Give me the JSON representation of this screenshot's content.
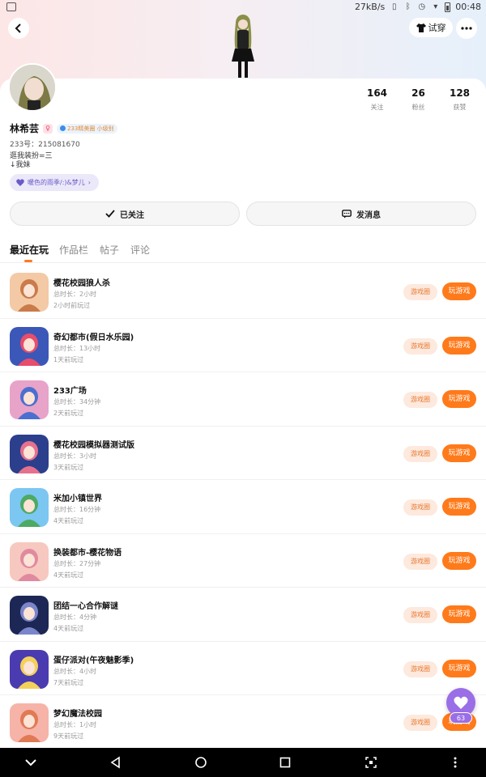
{
  "status_bar": {
    "net_speed": "27kB/s",
    "time": "00:48"
  },
  "header": {
    "tryon_label": "试穿"
  },
  "profile": {
    "name": "林希芸",
    "level_badge": "233精美圈 小级别",
    "account_id": "233号：215081670",
    "bio_line1": "逛我装扮=三",
    "bio_line2": "↓我妹",
    "tag": "暖色的雨季/:)&梦儿",
    "stats": [
      {
        "num": "164",
        "label": "关注"
      },
      {
        "num": "26",
        "label": "粉丝"
      },
      {
        "num": "128",
        "label": "获赞"
      }
    ],
    "follow_label": "已关注",
    "message_label": "发消息"
  },
  "tabs": [
    "最近在玩",
    "作品栏",
    "帖子",
    "评论"
  ],
  "buttons": {
    "circle": "游戏圈",
    "play": "玩游戏"
  },
  "games": [
    {
      "name": "樱花校园狼人杀",
      "duration": "总时长：2小时",
      "last": "2小时前玩过"
    },
    {
      "name": "奇幻都市(假日水乐园)",
      "duration": "总时长：13小时",
      "last": "1天前玩过"
    },
    {
      "name": "233广场",
      "duration": "总时长：34分钟",
      "last": "2天前玩过"
    },
    {
      "name": "樱花校园模拟器测试版",
      "duration": "总时长：3小时",
      "last": "3天前玩过"
    },
    {
      "name": "米加小镇世界",
      "duration": "总时长：16分钟",
      "last": "4天前玩过"
    },
    {
      "name": "换装都市-樱花物语",
      "duration": "总时长：27分钟",
      "last": "4天前玩过"
    },
    {
      "name": "团结一心合作解谜",
      "duration": "总时长：4分钟",
      "last": "4天前玩过"
    },
    {
      "name": "蛋仔派对(午夜魅影季)",
      "duration": "总时长：4小时",
      "last": "7天前玩过"
    },
    {
      "name": "梦幻魔法校园",
      "duration": "总时长：1小时",
      "last": "9天前玩过"
    }
  ],
  "float_badge_count": "63",
  "colors": {
    "accent": "#ff7a1a",
    "purple": "#9a6ee6"
  }
}
